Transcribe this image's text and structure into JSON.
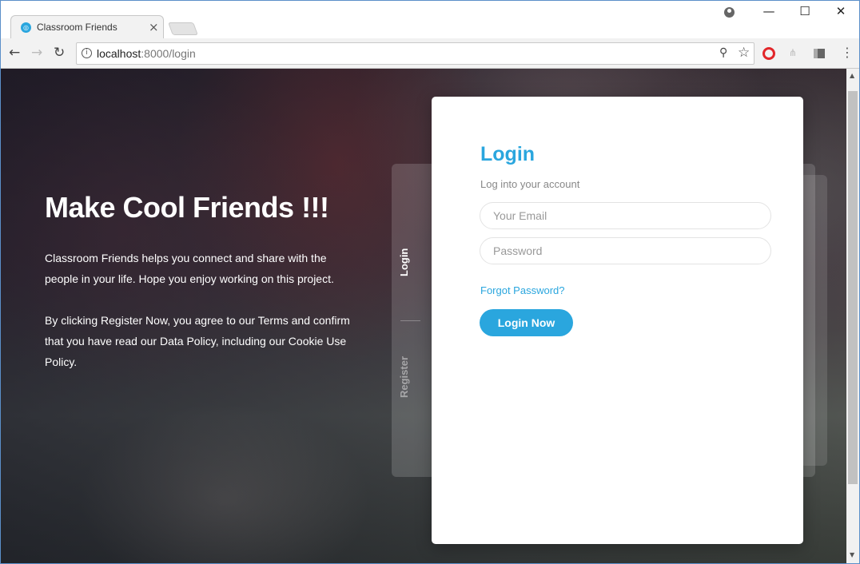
{
  "browser": {
    "tab_title": "Classroom Friends",
    "tab_close": "×",
    "url_host": "localhost",
    "url_path": ":8000/login",
    "window_controls": {
      "minimize": "—",
      "maximize": "☐",
      "close": "✕"
    }
  },
  "icons": {
    "back": "←",
    "forward": "→",
    "reload": "↻",
    "star": "☆",
    "menu": "⋮",
    "key": "⚲"
  },
  "hero": {
    "title": "Make Cool Friends !!!",
    "paragraph1": "Classroom Friends helps you connect and share with the people in your life. Hope you enjoy working on this project.",
    "paragraph2": "By clicking Register Now, you agree to our Terms and confirm that you have read our Data Policy, including our Cookie Use Policy."
  },
  "side_tabs": {
    "login": "Login",
    "register": "Register"
  },
  "login_card": {
    "title": "Login",
    "subtitle": "Log into your account",
    "email_placeholder": "Your Email",
    "password_placeholder": "Password",
    "forgot_link": "Forgot Password?",
    "submit_label": "Login Now"
  },
  "colors": {
    "accent": "#2aa6de",
    "opera_red": "#e2262a"
  }
}
